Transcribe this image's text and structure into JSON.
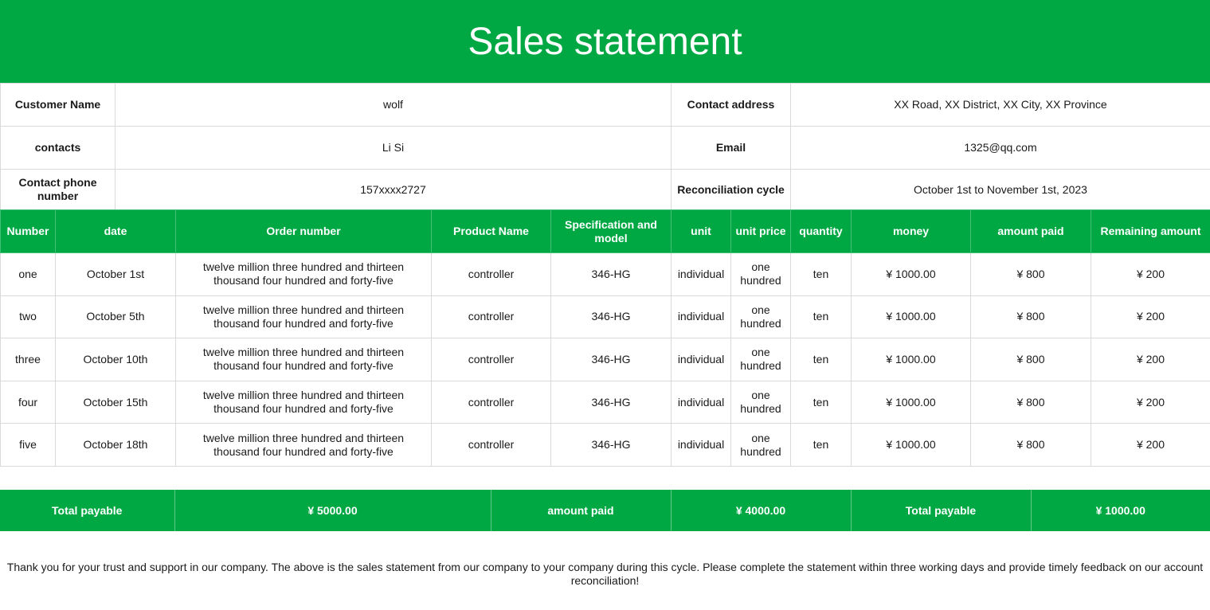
{
  "title": "Sales statement",
  "info": {
    "customer_name_label": "Customer Name",
    "customer_name": "wolf",
    "contact_address_label": "Contact address",
    "contact_address": "XX Road, XX District, XX City, XX Province",
    "contacts_label": "contacts",
    "contacts": "Li Si",
    "email_label": "Email",
    "email": "1325@qq.com",
    "phone_label": "Contact phone number",
    "phone": "157xxxx2727",
    "cycle_label": "Reconciliation cycle",
    "cycle": "October 1st to November 1st, 2023"
  },
  "table": {
    "headers": [
      "Number",
      "date",
      "Order number",
      "Product Name",
      "Specification and model",
      "unit",
      "unit price",
      "quantity",
      "money",
      "amount paid",
      "Remaining amount"
    ],
    "rows": [
      [
        "one",
        "October 1st",
        "twelve million three hundred and thirteen thousand four hundred and forty-five",
        "controller",
        "346-HG",
        "individual",
        "one hundred",
        "ten",
        "¥ 1000.00",
        "¥ 800",
        "¥ 200"
      ],
      [
        "two",
        "October 5th",
        "twelve million three hundred and thirteen thousand four hundred and forty-five",
        "controller",
        "346-HG",
        "individual",
        "one hundred",
        "ten",
        "¥ 1000.00",
        "¥ 800",
        "¥ 200"
      ],
      [
        "three",
        "October 10th",
        "twelve million three hundred and thirteen thousand four hundred and forty-five",
        "controller",
        "346-HG",
        "individual",
        "one hundred",
        "ten",
        "¥ 1000.00",
        "¥ 800",
        "¥ 200"
      ],
      [
        "four",
        "October 15th",
        "twelve million three hundred and thirteen thousand four hundred and forty-five",
        "controller",
        "346-HG",
        "individual",
        "one hundred",
        "ten",
        "¥ 1000.00",
        "¥ 800",
        "¥ 200"
      ],
      [
        "five",
        "October 18th",
        "twelve million three hundred and thirteen thousand four hundred and forty-five",
        "controller",
        "346-HG",
        "individual",
        "one hundred",
        "ten",
        "¥ 1000.00",
        "¥ 800",
        "¥ 200"
      ]
    ]
  },
  "totals": {
    "total_payable_label": "Total payable",
    "total_payable": "¥ 5000.00",
    "amount_paid_label": "amount paid",
    "amount_paid": "¥ 4000.00",
    "remaining_label": "Total payable",
    "remaining": "¥ 1000.00"
  },
  "footer": "Thank you for your trust and support in our company. The above is the sales statement from our company to your company during this cycle. Please complete the statement within three working days and provide timely feedback on our account reconciliation!",
  "colors": {
    "accent": "#00a844",
    "border": "#d9d9d9"
  }
}
